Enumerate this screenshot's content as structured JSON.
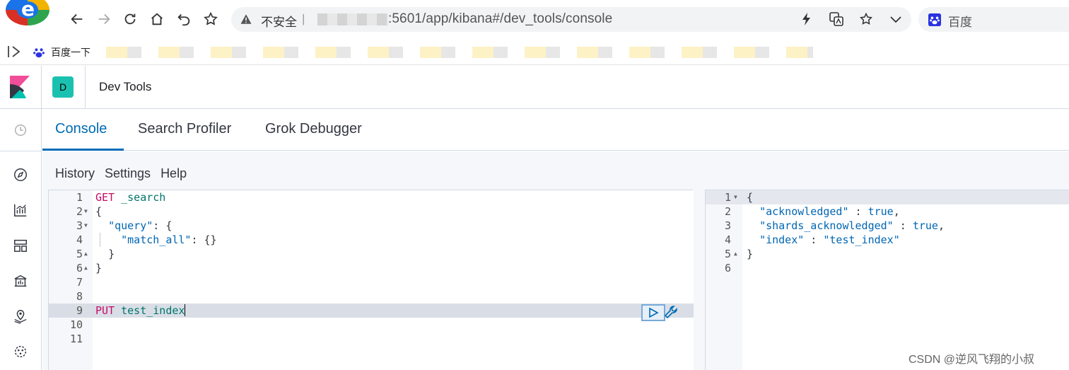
{
  "browser": {
    "url_security": "不安全",
    "url_text": ":5601/app/kibana#/dev_tools/console",
    "search_engine": "百度",
    "bookmark_first": "百度一下"
  },
  "header": {
    "space_initial": "D",
    "breadcrumb": "Dev Tools",
    "space_color": "#1bc1b0"
  },
  "tabs": [
    {
      "label": "Console",
      "active": true
    },
    {
      "label": "Search Profiler",
      "active": false
    },
    {
      "label": "Grok Debugger",
      "active": false
    }
  ],
  "menu": {
    "history": "History",
    "settings": "Settings",
    "help": "Help"
  },
  "editor": {
    "line_numbers": [
      "1",
      "2",
      "3",
      "4",
      "5",
      "6",
      "7",
      "8",
      "9",
      "10",
      "11"
    ],
    "active_line": 9,
    "lines": {
      "l1_method": "GET",
      "l1_path": "_search",
      "l2": "{",
      "l3_key": "\"query\"",
      "l3_rest": ": {",
      "l4_key": "\"match_all\"",
      "l4_rest": ": {}",
      "l5": "}",
      "l6": "}",
      "l9_method": "PUT",
      "l9_path": "test_index"
    }
  },
  "output": {
    "line_numbers": [
      "1",
      "2",
      "3",
      "4",
      "5",
      "6"
    ],
    "lines": {
      "l1": "{",
      "l2_key": "\"acknowledged\"",
      "l2_sep": " : ",
      "l2_val": "true",
      "l2_end": ",",
      "l3_key": "\"shards_acknowledged\"",
      "l3_sep": " : ",
      "l3_val": "true",
      "l3_end": ",",
      "l4_key": "\"index\"",
      "l4_sep": " : ",
      "l4_val": "\"test_index\"",
      "l5": "}"
    }
  },
  "watermark": "CSDN @逆风飞翔的小叔",
  "colors": {
    "accent": "#006bb4",
    "method": "#c80a68",
    "path": "#00756c",
    "json_key": "#0066b3"
  }
}
